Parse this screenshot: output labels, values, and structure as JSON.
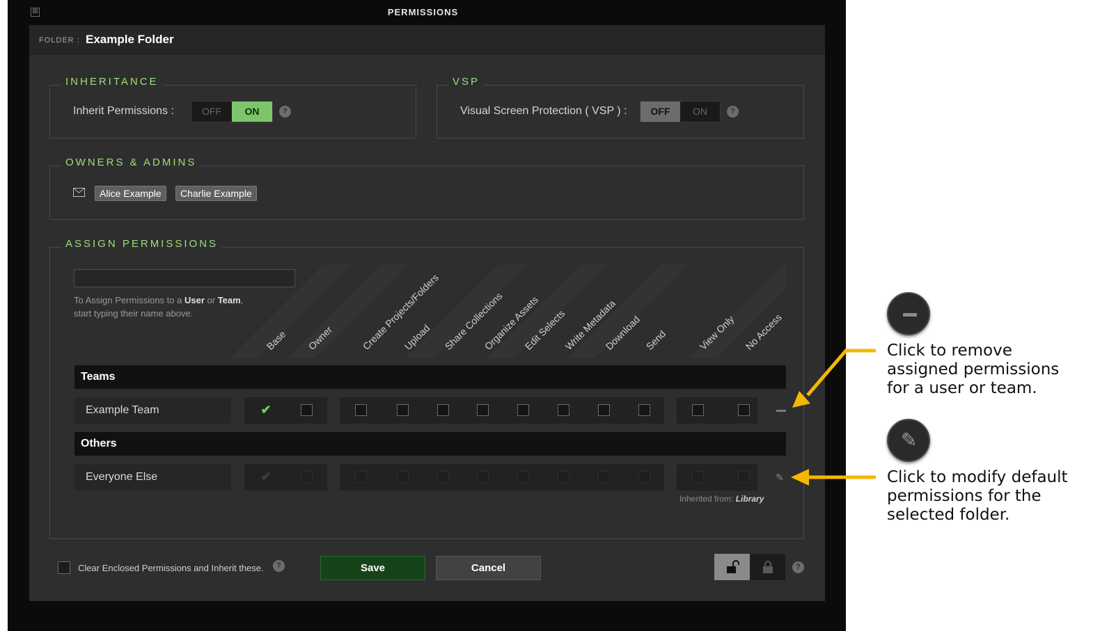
{
  "window": {
    "title": "PERMISSIONS",
    "close_glyph": "⊠"
  },
  "folder": {
    "label": "FOLDER :",
    "name": "Example Folder"
  },
  "inheritance": {
    "legend": "INHERITANCE",
    "label": "Inherit Permissions :",
    "off": "OFF",
    "on": "ON",
    "state": "ON"
  },
  "vsp": {
    "legend": "VSP",
    "label": "Visual Screen Protection ( VSP ) :",
    "off": "OFF",
    "on": "ON",
    "state": "OFF"
  },
  "owners": {
    "legend": "OWNERS & ADMINS",
    "icon": "mail-icon",
    "chips": [
      "Alice Example",
      "Charlie Example"
    ]
  },
  "assign": {
    "legend": "ASSIGN PERMISSIONS",
    "input_value": "",
    "hint_pre": "To Assign Permissions to a ",
    "hint_user": "User",
    "hint_or": " or ",
    "hint_team": "Team",
    "hint_post": ",",
    "hint_line2": "start typing their name above.",
    "columns": [
      "Base",
      "Owner",
      "Create Projects/Folders",
      "Upload",
      "Share Collections",
      "Organize Assets",
      "Edit Selects",
      "Write Metadata",
      "Download",
      "Send",
      "View Only",
      "No Access"
    ],
    "groups": [
      {
        "title": "Teams",
        "rows": [
          {
            "name": "Example Team",
            "checked": [
              true,
              false,
              false,
              false,
              false,
              false,
              false,
              false,
              false,
              false,
              false,
              false
            ],
            "action": "remove"
          }
        ]
      },
      {
        "title": "Others",
        "rows": [
          {
            "name": "Everyone Else",
            "checked": [
              true,
              false,
              false,
              false,
              false,
              false,
              false,
              false,
              false,
              false,
              false,
              false
            ],
            "action": "edit"
          }
        ]
      }
    ],
    "inherited_label": "Inherited from: ",
    "inherited_from": "Library"
  },
  "footer": {
    "clear_label": "Clear Enclosed Permissions and Inherit these.",
    "save": "Save",
    "cancel": "Cancel"
  },
  "callouts": {
    "remove": {
      "icon": "minus-icon",
      "lines": [
        "Click to remove",
        "assigned permissions",
        "for a user or team."
      ]
    },
    "edit": {
      "icon": "pencil-icon",
      "lines": [
        "Click to modify default",
        "permissions for the",
        "selected folder."
      ]
    }
  },
  "colors": {
    "accent_green": "#9be07a",
    "on_green": "#7cc66a",
    "save_green": "#17431a",
    "arrow_yellow": "#f5b800"
  }
}
